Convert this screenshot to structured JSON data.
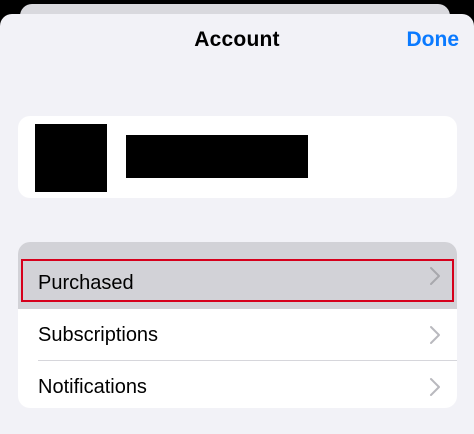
{
  "header": {
    "title": "Account",
    "done_label": "Done"
  },
  "menu": {
    "items": [
      {
        "label": "Purchased"
      },
      {
        "label": "Subscriptions"
      },
      {
        "label": "Notifications"
      }
    ]
  },
  "colors": {
    "accent": "#0a7aff",
    "highlight": "#d6001c",
    "background": "#f2f2f7"
  },
  "icons": {
    "row_chevron": "chevron-right-icon"
  }
}
